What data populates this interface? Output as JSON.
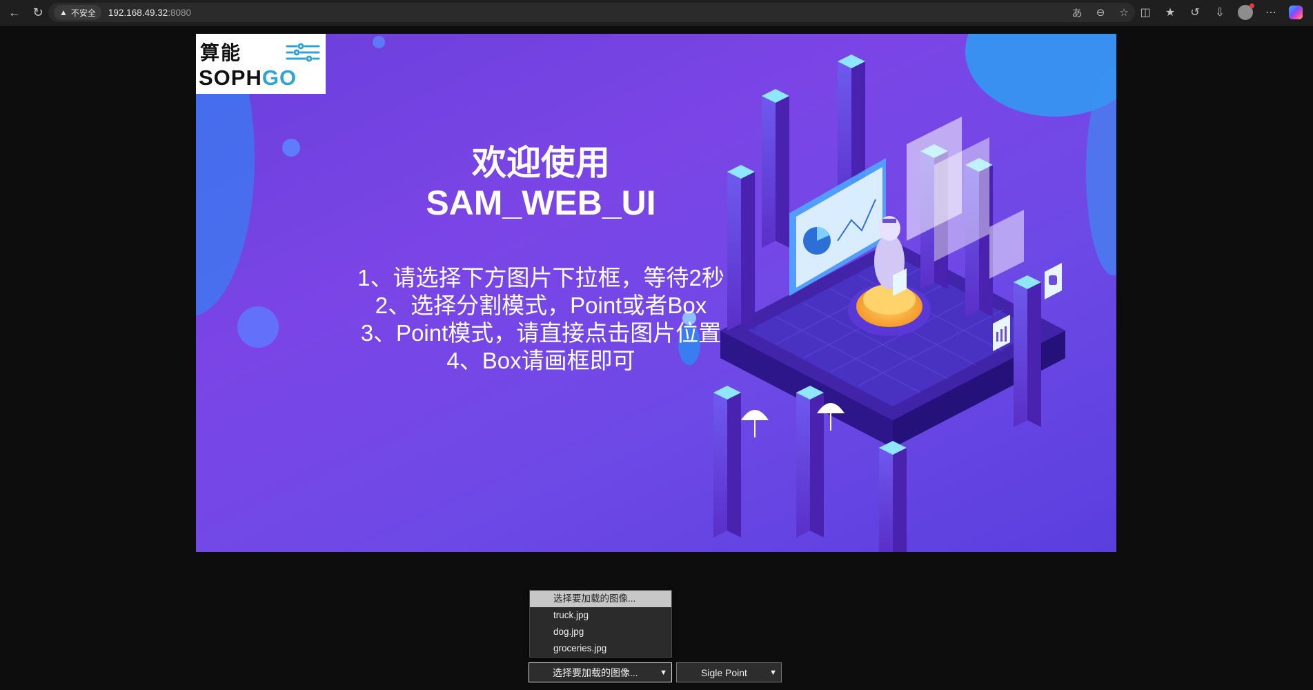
{
  "browser": {
    "security_label": "不安全",
    "url_host": "192.168.49.32",
    "url_port": ":8080"
  },
  "logo": {
    "cn": "算能",
    "en_part1": "SOPH",
    "en_part2": "GO"
  },
  "banner": {
    "welcome_line1": "欢迎使用",
    "welcome_line2": "SAM_WEB_UI",
    "instructions": [
      "1、请选择下方图片下拉框，等待2秒",
      "2、选择分割模式，Point或者Box",
      "3、Point模式，请直接点击图片位置",
      "4、Box请画框即可"
    ]
  },
  "image_select": {
    "value": "选择要加载的图像...",
    "options": [
      "选择要加载的图像...",
      "truck.jpg",
      "dog.jpg",
      "groceries.jpg"
    ]
  },
  "mode_select": {
    "value": "Sigle Point"
  },
  "colors": {
    "banner_purple": "#6a3fdc",
    "iso_cyan": "#54d1ff",
    "page_bg": "#0d0d0d"
  }
}
